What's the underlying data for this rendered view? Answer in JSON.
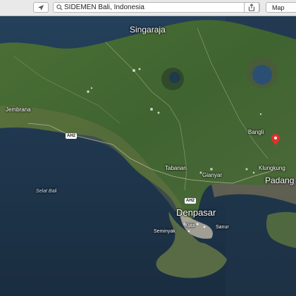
{
  "toolbar": {
    "search_query": "SIDEMEN Bali, Indonesia",
    "map_button_label": "Map",
    "icons": [
      "location-arrow-icon",
      "search-icon",
      "clear-icon",
      "share-icon"
    ]
  },
  "map": {
    "place_labels": {
      "singaraja": "Singaraja",
      "jembrana": "Jembrana",
      "bangli": "Bangli",
      "tabanan": "Tabanan",
      "gianyar": "Gianyar",
      "klungkung": "Klungkung",
      "padang": "Padang",
      "denpasar": "Denpasar",
      "kuta": "Kuta",
      "seminyak": "Seminyak",
      "sanur": "Sanur"
    },
    "water_labels": {
      "strait": "Selat Bali"
    },
    "road_labels": {
      "ah2_west": "AH2",
      "ah2_south": "AH2"
    },
    "pin_color": "#e0302a"
  }
}
